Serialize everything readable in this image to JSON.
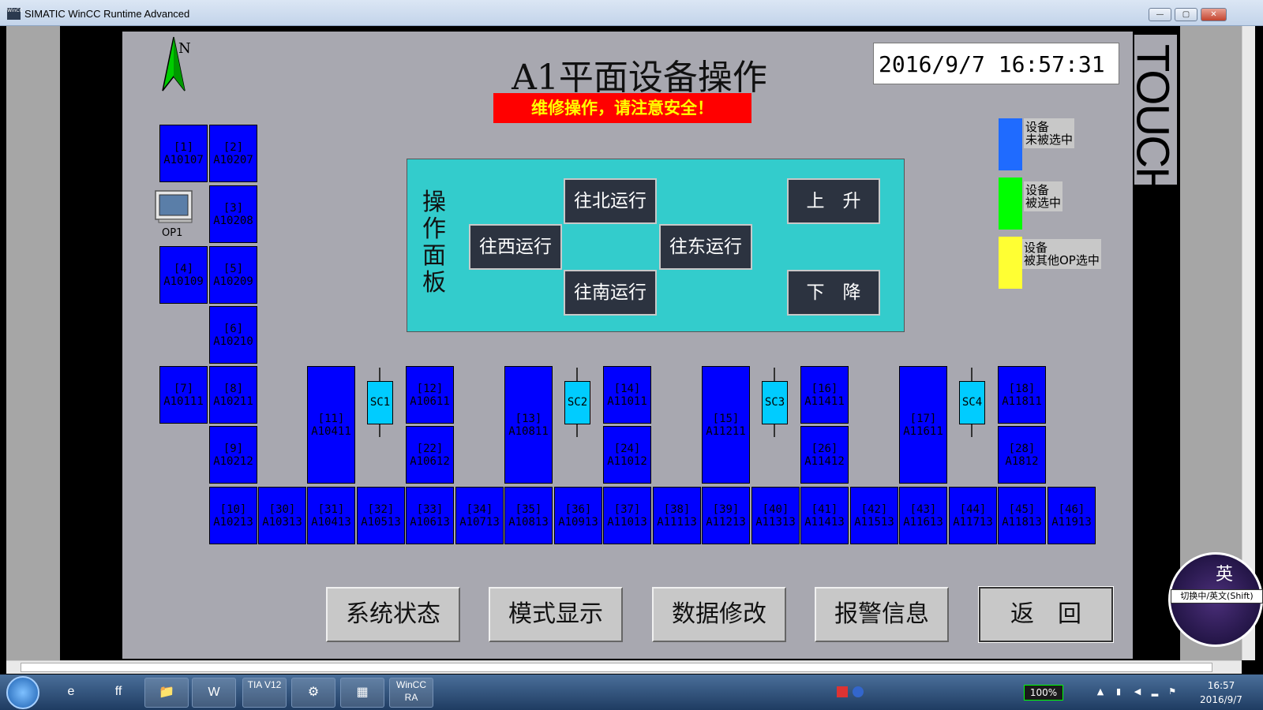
{
  "window": {
    "title": "SIMATIC WinCC Runtime Advanced",
    "icon_text": "WinCC",
    "minimize": "—",
    "maximize": "▢",
    "close": "✕"
  },
  "hmi": {
    "title": "A1平面设备操作",
    "warning": "维修操作，请注意安全！",
    "datetime": "2016/9/7  16:57:31",
    "touch": "TOUCH",
    "north": "N",
    "op1": "OP1",
    "legend": [
      {
        "label1": "设备",
        "label2": "未被选中",
        "color": "#1f6bff"
      },
      {
        "label1": "设备",
        "label2": "被选中",
        "color": "#00ff00"
      },
      {
        "label1": "设备",
        "label2": "被其他OP选中",
        "color": "#ffff33"
      }
    ],
    "panel": {
      "label": "操作面板",
      "north": "往北运行",
      "west": "往西运行",
      "east": "往东运行",
      "south": "往南运行",
      "up": "上　升",
      "down": "下　降"
    },
    "devices": {
      "d1": {
        "id": "[1]",
        "code": "A10107"
      },
      "d2": {
        "id": "[2]",
        "code": "A10207"
      },
      "d3": {
        "id": "[3]",
        "code": "A10208"
      },
      "d4": {
        "id": "[4]",
        "code": "A10109"
      },
      "d5": {
        "id": "[5]",
        "code": "A10209"
      },
      "d6": {
        "id": "[6]",
        "code": "A10210"
      },
      "d7": {
        "id": "[7]",
        "code": "A10111"
      },
      "d8": {
        "id": "[8]",
        "code": "A10211"
      },
      "d9": {
        "id": "[9]",
        "code": "A10212"
      },
      "d10": {
        "id": "[10]",
        "code": "A10213"
      },
      "d11": {
        "id": "[11]",
        "code": "A10411"
      },
      "d12": {
        "id": "[12]",
        "code": "A10611"
      },
      "d13": {
        "id": "[13]",
        "code": "A10811"
      },
      "d14": {
        "id": "[14]",
        "code": "A11011"
      },
      "d15": {
        "id": "[15]",
        "code": "A11211"
      },
      "d16": {
        "id": "[16]",
        "code": "A11411"
      },
      "d17": {
        "id": "[17]",
        "code": "A11611"
      },
      "d18": {
        "id": "[18]",
        "code": "A11811"
      },
      "d22": {
        "id": "[22]",
        "code": "A10612"
      },
      "d24": {
        "id": "[24]",
        "code": "A11012"
      },
      "d26": {
        "id": "[26]",
        "code": "A11412"
      },
      "d28": {
        "id": "[28]",
        "code": "A1812"
      },
      "d30": {
        "id": "[30]",
        "code": "A10313"
      },
      "d31": {
        "id": "[31]",
        "code": "A10413"
      },
      "d32": {
        "id": "[32]",
        "code": "A10513"
      },
      "d33": {
        "id": "[33]",
        "code": "A10613"
      },
      "d34": {
        "id": "[34]",
        "code": "A10713"
      },
      "d35": {
        "id": "[35]",
        "code": "A10813"
      },
      "d36": {
        "id": "[36]",
        "code": "A10913"
      },
      "d37": {
        "id": "[37]",
        "code": "A11013"
      },
      "d38": {
        "id": "[38]",
        "code": "A11113"
      },
      "d39": {
        "id": "[39]",
        "code": "A11213"
      },
      "d40": {
        "id": "[40]",
        "code": "A11313"
      },
      "d41": {
        "id": "[41]",
        "code": "A11413"
      },
      "d42": {
        "id": "[42]",
        "code": "A11513"
      },
      "d43": {
        "id": "[43]",
        "code": "A11613"
      },
      "d44": {
        "id": "[44]",
        "code": "A11713"
      },
      "d45": {
        "id": "[45]",
        "code": "A11813"
      },
      "d46": {
        "id": "[46]",
        "code": "A11913"
      }
    },
    "sc": {
      "sc1": "SC1",
      "sc2": "SC2",
      "sc3": "SC3",
      "sc4": "SC4"
    },
    "bottom_buttons": {
      "status": "系统状态",
      "mode": "模式显示",
      "data": "数据修改",
      "alarm": "报警信息",
      "back": "返　回"
    }
  },
  "ime": {
    "char": "英",
    "tip": "切换中/英文(Shift)"
  },
  "taskbar": {
    "items": [
      "e",
      "ff",
      "📁",
      "W",
      "TIA V12",
      "⚙",
      "▦",
      "WinCC RA"
    ],
    "battery": "100%",
    "time": "16:57",
    "date": "2016/9/7"
  }
}
